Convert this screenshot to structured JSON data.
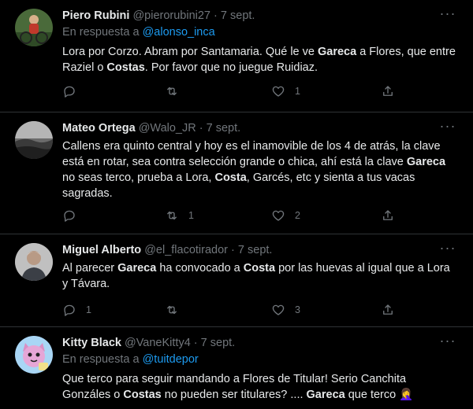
{
  "colors": {
    "background": "#000000",
    "text": "#e7e9ea",
    "muted": "#71767b",
    "link": "#1d9bf0",
    "divider": "#2f3336"
  },
  "tweets": [
    {
      "name": "Piero Rubini",
      "handle": "@pierorubini27",
      "dot": "·",
      "date": "7 sept.",
      "reply_prefix": "En respuesta a",
      "reply_link": "@alonso_inca",
      "body_runs": [
        {
          "t": "Lora por Corzo. Abram por Santamaria. Qué le ve "
        },
        {
          "t": "Gareca",
          "b": true
        },
        {
          "t": " a Flores, que entre Raziel o "
        },
        {
          "t": "Costas",
          "b": true
        },
        {
          "t": ". Por favor que no juegue Ruidiaz."
        }
      ],
      "reply_count": "",
      "retweet_count": "",
      "like_count": "1",
      "avatar_icon": "cyclist-avatar"
    },
    {
      "name": "Mateo Ortega",
      "handle": "@Walo_JR",
      "dot": "·",
      "date": "7 sept.",
      "body_runs": [
        {
          "t": "Callens era quinto central y hoy es el inamovible de los 4 de atrás, la clave está en rotar, sea contra selección grande o chica, ahí está la clave "
        },
        {
          "t": "Gareca",
          "b": true
        },
        {
          "t": " no seas terco, prueba a Lora, "
        },
        {
          "t": "Costa",
          "b": true
        },
        {
          "t": ", Garcés, etc y sienta a tus vacas sagradas."
        }
      ],
      "reply_count": "",
      "retweet_count": "1",
      "like_count": "2",
      "avatar_icon": "landscape-avatar"
    },
    {
      "name": "Miguel Alberto",
      "handle": "@el_flacotirador",
      "dot": "·",
      "date": "7 sept.",
      "body_runs": [
        {
          "t": "Al parecer "
        },
        {
          "t": "Gareca",
          "b": true
        },
        {
          "t": " ha convocado a "
        },
        {
          "t": "Costa",
          "b": true
        },
        {
          "t": " por las huevas al igual que a Lora y Távara."
        }
      ],
      "reply_count": "1",
      "retweet_count": "",
      "like_count": "3",
      "avatar_icon": "portrait-avatar"
    },
    {
      "name": "Kitty Black",
      "handle": "@VaneKitty4",
      "dot": "·",
      "date": "7 sept.",
      "reply_prefix": "En respuesta a",
      "reply_link": "@tuitdepor",
      "body_runs": [
        {
          "t": "Que terco para seguir mandando a Flores de Titular! Serio Canchita Gonzáles o "
        },
        {
          "t": "Costas",
          "b": true
        },
        {
          "t": " no pueden ser titulares? .... "
        },
        {
          "t": "Gareca",
          "b": true
        },
        {
          "t": " que terco 🤦‍♀️"
        }
      ],
      "reply_count": "",
      "retweet_count": "",
      "like_count": "",
      "avatar_icon": "cartoon-cat-avatar"
    }
  ]
}
